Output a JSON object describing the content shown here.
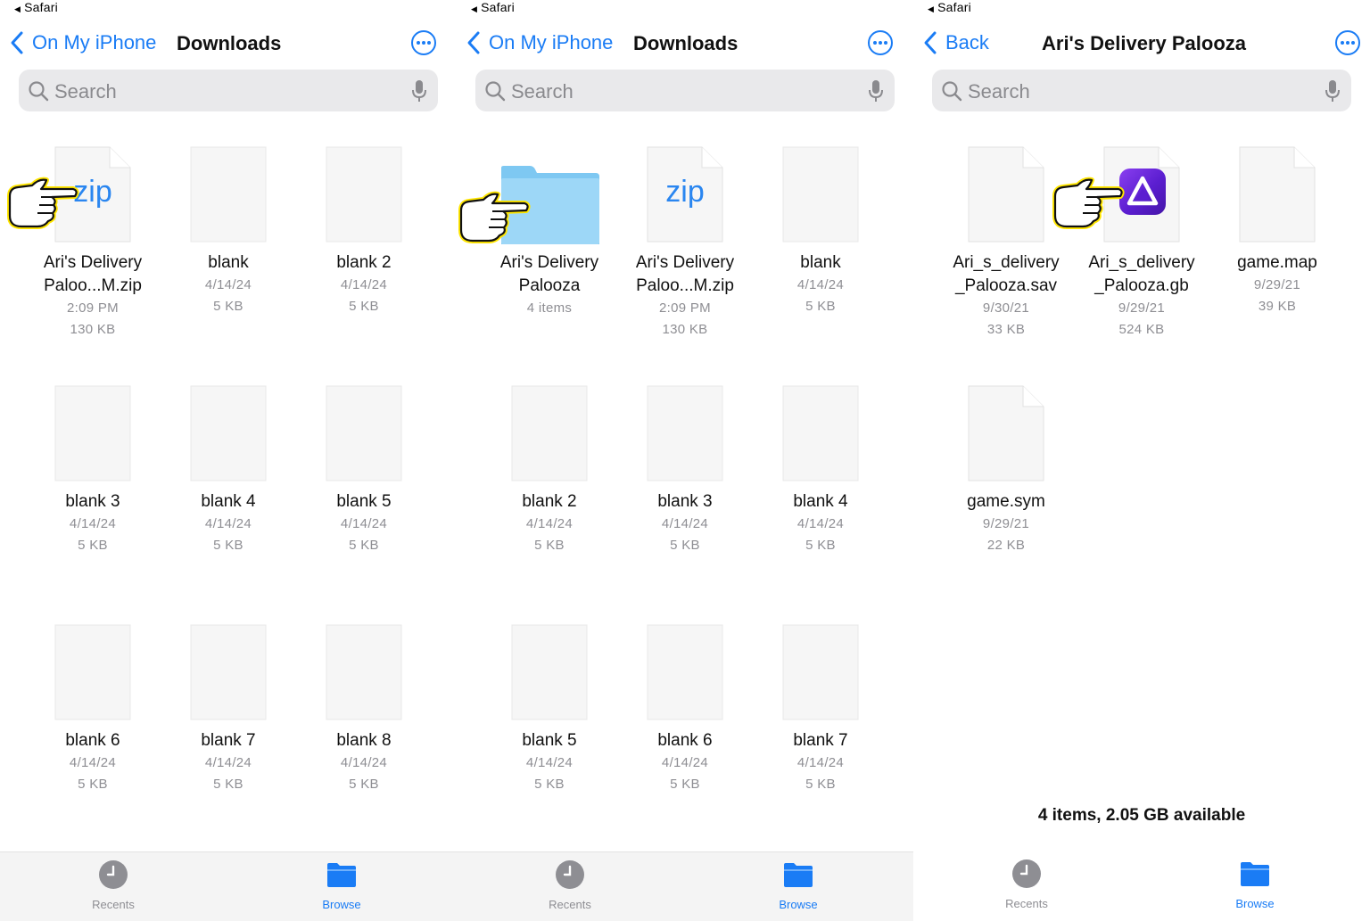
{
  "colors": {
    "accent": "#1a7cf5",
    "folder": "#8fd0f5",
    "app_icon": "#6a2ae0",
    "highlight": "#ffe600"
  },
  "panels": [
    {
      "status_back": "Safari",
      "back_label": "On My iPhone",
      "title": "Downloads",
      "search_placeholder": "Search",
      "items": [
        {
          "type": "zip",
          "name_line1": "Ari's Delivery",
          "name_line2": "Paloo...M.zip",
          "meta1": "2:09 PM",
          "meta2": "130 KB",
          "icon_text": "zip"
        },
        {
          "type": "doc",
          "name_line1": "blank",
          "meta1": "4/14/24",
          "meta2": "5 KB"
        },
        {
          "type": "doc",
          "name_line1": "blank 2",
          "meta1": "4/14/24",
          "meta2": "5 KB"
        },
        {
          "type": "doc",
          "name_line1": "blank 3",
          "meta1": "4/14/24",
          "meta2": "5 KB"
        },
        {
          "type": "doc",
          "name_line1": "blank 4",
          "meta1": "4/14/24",
          "meta2": "5 KB"
        },
        {
          "type": "doc",
          "name_line1": "blank 5",
          "meta1": "4/14/24",
          "meta2": "5 KB"
        },
        {
          "type": "doc",
          "name_line1": "blank 6",
          "meta1": "4/14/24",
          "meta2": "5 KB"
        },
        {
          "type": "doc",
          "name_line1": "blank 7",
          "meta1": "4/14/24",
          "meta2": "5 KB"
        },
        {
          "type": "doc",
          "name_line1": "blank 8",
          "meta1": "4/14/24",
          "meta2": "5 KB"
        }
      ],
      "tabs": {
        "recents": "Recents",
        "browse": "Browse"
      }
    },
    {
      "status_back": "Safari",
      "back_label": "On My iPhone",
      "title": "Downloads",
      "search_placeholder": "Search",
      "items": [
        {
          "type": "folder",
          "name_line1": "Ari's Delivery",
          "name_line2": "Palooza",
          "meta1": "4 items"
        },
        {
          "type": "zip",
          "name_line1": "Ari's Delivery",
          "name_line2": "Paloo...M.zip",
          "meta1": "2:09 PM",
          "meta2": "130 KB",
          "icon_text": "zip"
        },
        {
          "type": "doc",
          "name_line1": "blank",
          "meta1": "4/14/24",
          "meta2": "5 KB"
        },
        {
          "type": "doc",
          "name_line1": "blank 2",
          "meta1": "4/14/24",
          "meta2": "5 KB"
        },
        {
          "type": "doc",
          "name_line1": "blank 3",
          "meta1": "4/14/24",
          "meta2": "5 KB"
        },
        {
          "type": "doc",
          "name_line1": "blank 4",
          "meta1": "4/14/24",
          "meta2": "5 KB"
        },
        {
          "type": "doc",
          "name_line1": "blank 5",
          "meta1": "4/14/24",
          "meta2": "5 KB"
        },
        {
          "type": "doc",
          "name_line1": "blank 6",
          "meta1": "4/14/24",
          "meta2": "5 KB"
        },
        {
          "type": "doc",
          "name_line1": "blank 7",
          "meta1": "4/14/24",
          "meta2": "5 KB"
        }
      ],
      "tabs": {
        "recents": "Recents",
        "browse": "Browse"
      }
    },
    {
      "status_back": "Safari",
      "back_label": "Back",
      "title": "Ari's Delivery Palooza",
      "search_placeholder": "Search",
      "items": [
        {
          "type": "doc",
          "name_line1": "Ari_s_delivery",
          "name_line2": "_Palooza.sav",
          "meta1": "9/30/21",
          "meta2": "33 KB"
        },
        {
          "type": "app",
          "name_line1": "Ari_s_delivery",
          "name_line2": "_Palooza.gb",
          "meta1": "9/29/21",
          "meta2": "524 KB"
        },
        {
          "type": "doc",
          "name_line1": "game.map",
          "meta1": "9/29/21",
          "meta2": "39 KB"
        },
        {
          "type": "doc",
          "name_line1": "game.sym",
          "meta1": "9/29/21",
          "meta2": "22 KB"
        }
      ],
      "footer_info": "4 items, 2.05 GB available",
      "tabs": {
        "recents": "Recents",
        "browse": "Browse"
      }
    }
  ]
}
